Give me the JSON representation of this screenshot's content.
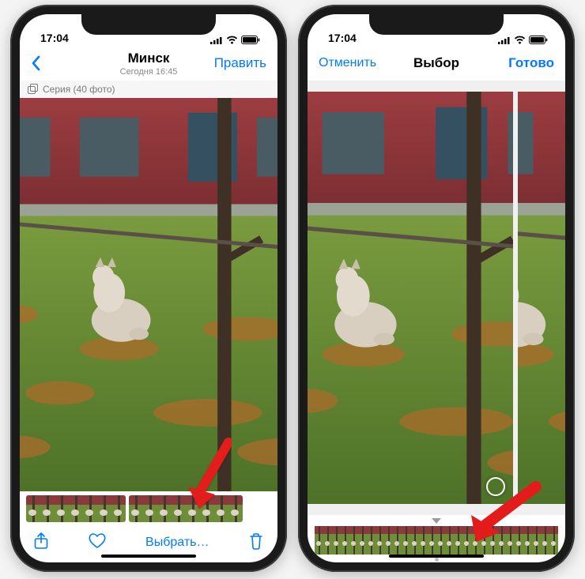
{
  "colors": {
    "accent": "#007aff",
    "muted": "#8a8a8a"
  },
  "left_phone": {
    "status": {
      "time": "17:04"
    },
    "nav": {
      "title": "Минск",
      "subtitle": "Сегодня 16:45",
      "edit_label": "Править"
    },
    "burst_label": "Серия (40 фото)",
    "toolbar": {
      "select_label": "Выбрать…"
    }
  },
  "right_phone": {
    "status": {
      "time": "17:04"
    },
    "nav": {
      "cancel_label": "Отменить",
      "title": "Выбор",
      "done_label": "Готово"
    },
    "strip_count": 28
  }
}
